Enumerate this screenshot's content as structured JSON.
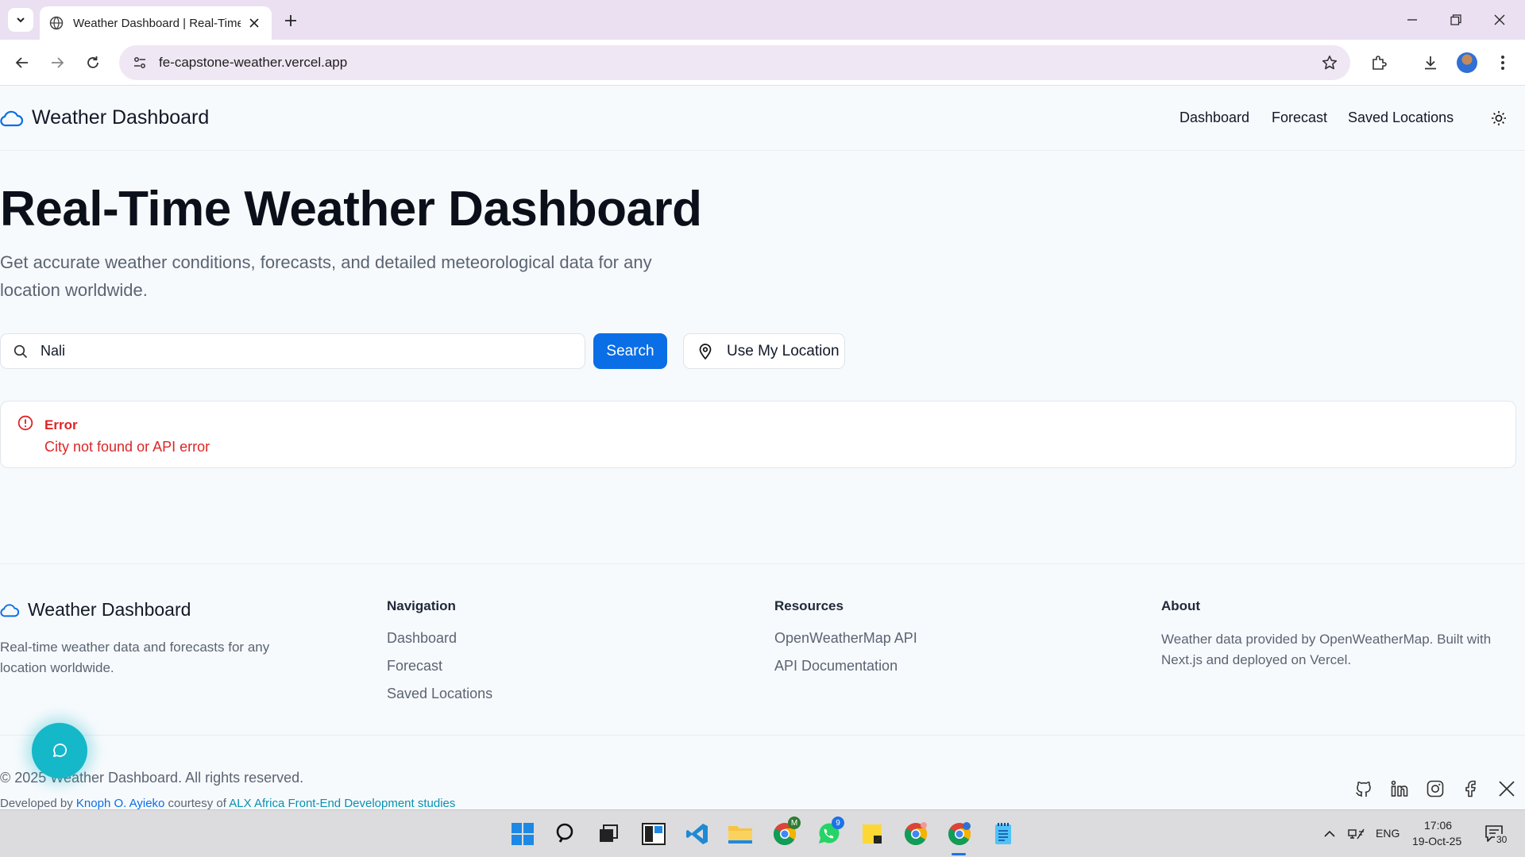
{
  "browser": {
    "tab_title": "Weather Dashboard | Real-Time Weather",
    "url": "fe-capstone-weather.vercel.app"
  },
  "header": {
    "brand": "Weather Dashboard",
    "nav": [
      "Dashboard",
      "Forecast",
      "Saved Locations"
    ]
  },
  "hero": {
    "title": "Real-Time Weather Dashboard",
    "subtitle": "Get accurate weather conditions, forecasts, and detailed meteorological data for any location worldwide."
  },
  "search": {
    "value": "Nali",
    "button_label": "Search",
    "location_button_label": "Use My Location"
  },
  "error": {
    "title": "Error",
    "message": "City not found or API error"
  },
  "footer": {
    "brand": "Weather Dashboard",
    "description": "Real-time weather data and forecasts for any location worldwide.",
    "navigation_heading": "Navigation",
    "navigation_links": [
      "Dashboard",
      "Forecast",
      "Saved Locations"
    ],
    "resources_heading": "Resources",
    "resources_links": [
      "OpenWeatherMap API",
      "API Documentation"
    ],
    "about_heading": "About",
    "about_text": "Weather data provided by OpenWeatherMap. Built with Next.js and deployed on Vercel.",
    "copyright": "© 2025 Weather Dashboard. All rights reserved.",
    "credits_prefix": "Developed by ",
    "credits_author": "Knoph O. Ayieko",
    "credits_middle": " courtesy of ",
    "credits_org": "ALX Africa Front-End Development studies"
  },
  "taskbar": {
    "language": "ENG",
    "time": "17:06",
    "date": "19-Oct-25",
    "notification_count": "30",
    "chrome_badge": "M",
    "whatsapp_badge": "9"
  },
  "colors": {
    "accent": "#0a6ee6",
    "error": "#dc2626",
    "fab": "#14b8c8"
  }
}
